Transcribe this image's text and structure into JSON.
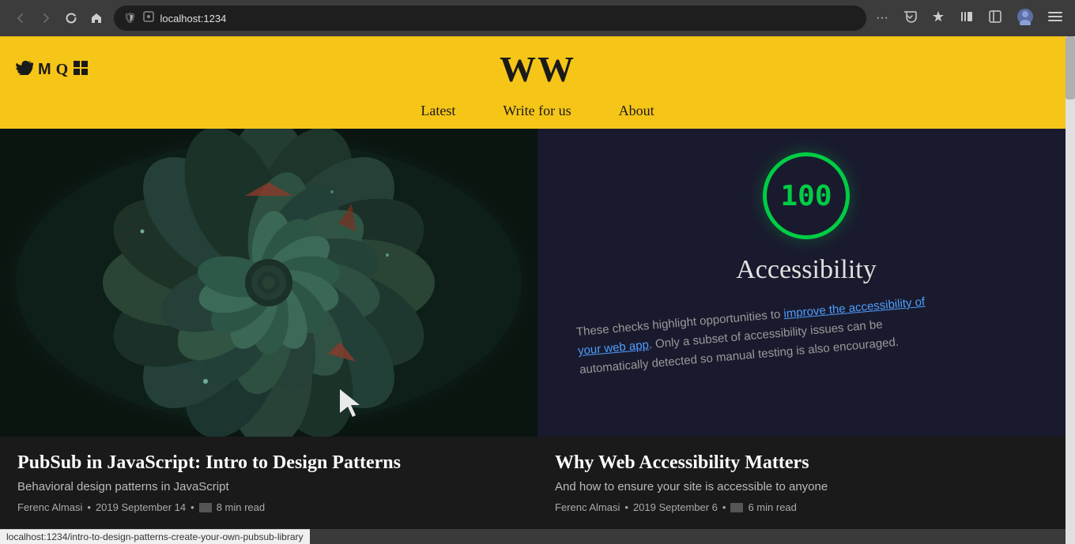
{
  "browser": {
    "back_label": "←",
    "forward_label": "→",
    "reload_label": "↺",
    "home_label": "⌂",
    "url": "localhost:1234",
    "more_label": "···",
    "pocket_label": "☰",
    "star_label": "★",
    "library_label": "⊞",
    "sidepanel_label": "⊡",
    "profile_label": "👤",
    "menu_label": "≡"
  },
  "site": {
    "logo": "WW",
    "social_icons": [
      "𝕏",
      "M",
      "Q",
      "▦"
    ],
    "nav": {
      "latest": "Latest",
      "write": "Write for us",
      "about": "About"
    }
  },
  "articles": [
    {
      "id": "article-1",
      "title": "PubSub in JavaScript: Intro to Design Patterns",
      "subtitle": "Behavioral design patterns in JavaScript",
      "author": "Ferenc Almasi",
      "date": "2019 September 14",
      "read_time": "8 min read",
      "url": "localhost:1234/intro-to-design-patterns-create-your-own-pubsub-library"
    },
    {
      "id": "article-2",
      "title": "Why Web Accessibility Matters",
      "subtitle": "And how to ensure your site is accessible to anyone",
      "author": "Ferenc Almasi",
      "date": "2019 September 6",
      "read_time": "6 min read",
      "url": ""
    }
  ],
  "accessibility_card": {
    "score": "100",
    "title": "Accessibility",
    "line1": "These checks highlight opportunities to improve the accessibility of",
    "line2": "your web app. Only a subset of accessibility issues can be",
    "line3": "automatically detected so manual testing is also encouraged."
  },
  "status_bar": {
    "url": "localhost:1234/intro-to-design-patterns-create-your-own-pubsub-library"
  }
}
